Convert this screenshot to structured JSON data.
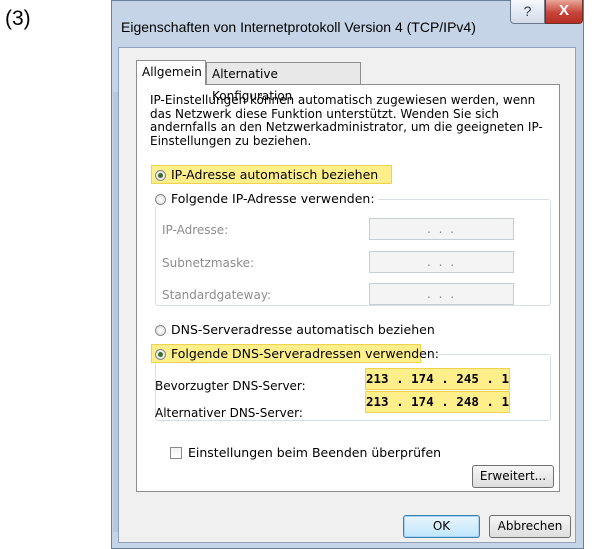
{
  "step_label": "(3)",
  "window": {
    "title": "Eigenschaften von Internetprotokoll Version 4 (TCP/IPv4)",
    "help_label": "?",
    "close_label": "X"
  },
  "tabs": [
    {
      "label": "Allgemein",
      "active": true
    },
    {
      "label": "Alternative Konfiguration",
      "active": false
    }
  ],
  "description": "IP-Einstellungen können automatisch zugewiesen werden, wenn das Netzwerk diese Funktion unterstützt. Wenden Sie sich andernfalls an den Netzwerkadministrator, um die geeigneten IP-Einstellungen zu beziehen.",
  "ip": {
    "auto_label": "IP-Adresse automatisch beziehen",
    "manual_label": "Folgende IP-Adresse verwenden:",
    "selected": "auto",
    "fields": [
      {
        "label": "IP-Adresse:",
        "value": ".   .   ."
      },
      {
        "label": "Subnetzmaske:",
        "value": ".   .   ."
      },
      {
        "label": "Standardgateway:",
        "value": ".   .   ."
      }
    ]
  },
  "dns": {
    "auto_label": "DNS-Serveradresse automatisch beziehen",
    "manual_label": "Folgende DNS-Serveradressen verwenden:",
    "selected": "manual",
    "preferred_label": "Bevorzugter DNS-Server:",
    "preferred_value": "213 . 174 . 245 . 1",
    "alternate_label": "Alternativer DNS-Server:",
    "alternate_value": "213 . 174 . 248 . 1"
  },
  "validate_label": "Einstellungen beim Beenden überprüfen",
  "validate_checked": false,
  "buttons": {
    "advanced": "Erweitert...",
    "ok": "OK",
    "cancel": "Abbrechen"
  },
  "colors": {
    "highlight": "#ffef8a",
    "frame": "#c5d4e6",
    "close_red": "#c7443a"
  }
}
